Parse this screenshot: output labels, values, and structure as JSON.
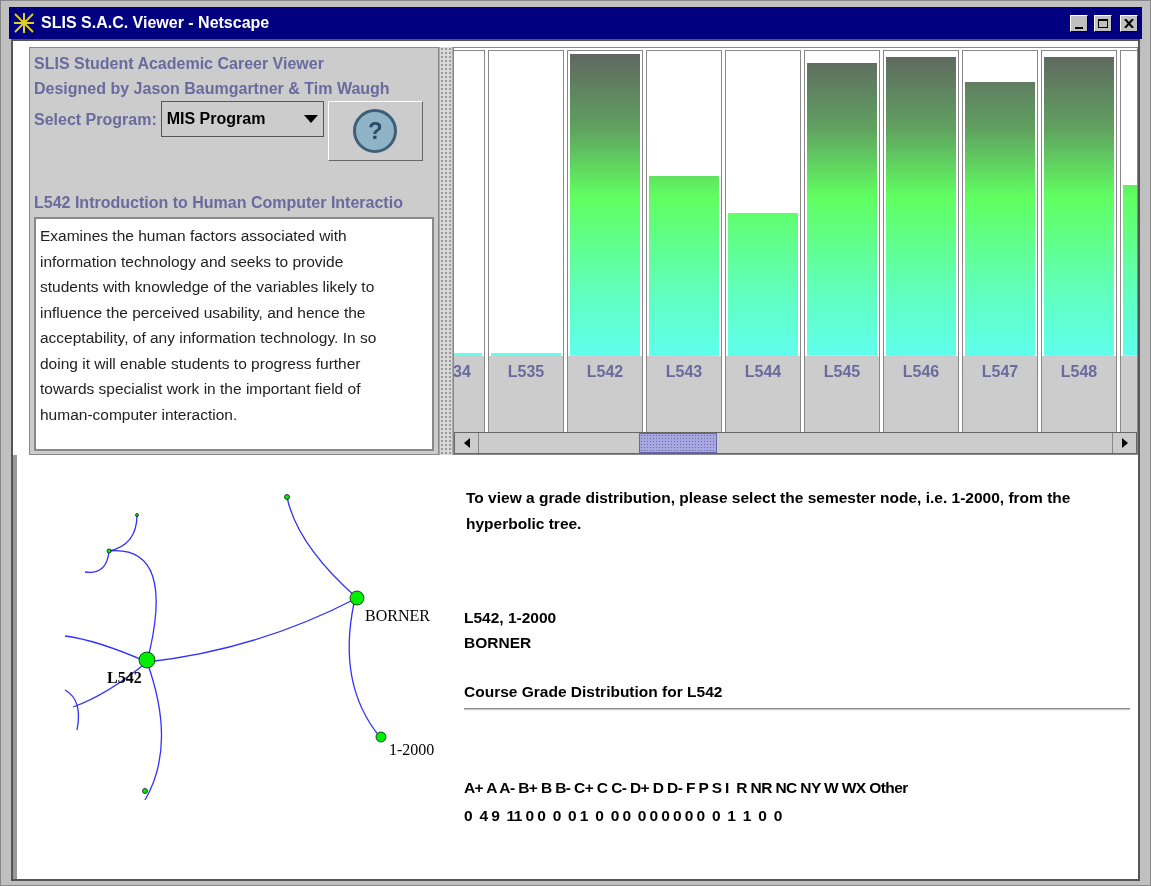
{
  "window": {
    "title": "SLIS S.A.C. Viewer - Netscape"
  },
  "header": {
    "line_1": "SLIS Student Academic Career Viewer",
    "line_2": "Designed by Jason Baumgartner & Tim Waugh",
    "program_label": "Select Program:",
    "program_value": "MIS Program",
    "help_button": "?"
  },
  "course": {
    "title": "L542 Introduction to Human Computer Interactio",
    "description": "Examines the human factors associated with information technology and seeks to provide students with knowledge of the variables likely to influence the perceived usability, and hence the acceptability, of any information technology. In so doing it will enable students to progress further towards specialist work in the important field of human-computer interaction."
  },
  "bars": [
    {
      "label": "34",
      "level": 0.01
    },
    {
      "label": "L535",
      "level": 0.01
    },
    {
      "label": "L542",
      "level": 0.99
    },
    {
      "label": "L543",
      "level": 0.59
    },
    {
      "label": "L544",
      "level": 0.47
    },
    {
      "label": "L545",
      "level": 0.96
    },
    {
      "label": "L546",
      "level": 0.98
    },
    {
      "label": "L547",
      "level": 0.9
    },
    {
      "label": "L548",
      "level": 0.98
    },
    {
      "level": 0.56
    }
  ],
  "tree": {
    "label": "L542",
    "children": [
      {
        "label": "BORNER",
        "children": [
          {
            "label": "1-2000"
          }
        ]
      }
    ]
  },
  "info": {
    "instruction": "To view a grade distribution, please select the semester node, i.e. 1-2000, from the hyperbolic tree.",
    "selection_line_1": "L542, 1-2000",
    "selection_line_2": "BORNER",
    "distribution_title": "Course Grade Distribution for L542",
    "grades_header": "A+ A A- B+ B B- C+ C C- D+ D D- F P S I  R NR NC NY W WX Other",
    "grades_counts": "0  4 9  11 0 0  0  0 1  0  0 0  0 0 0 0 0 0  0  1  1  0  0"
  }
}
